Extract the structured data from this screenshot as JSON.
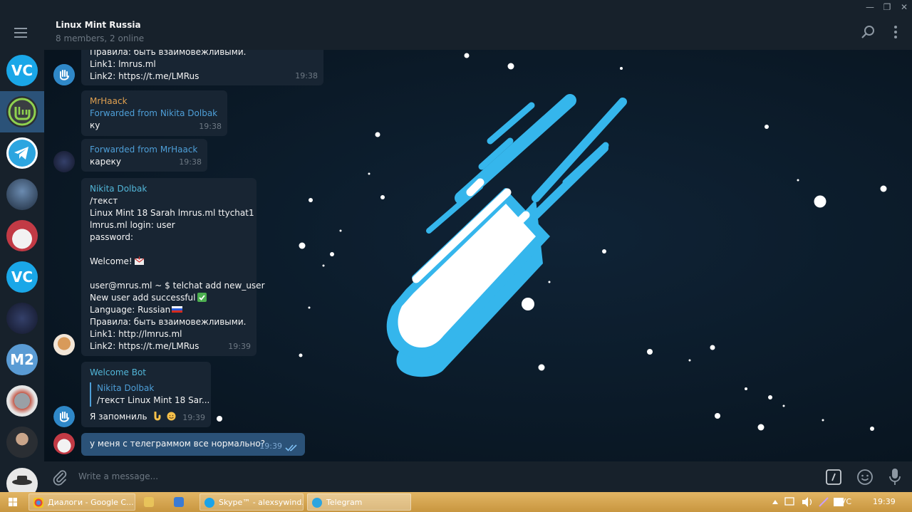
{
  "window": {
    "minimize": "—",
    "restore": "❐",
    "close": "✕"
  },
  "header": {
    "title": "Linux Mint Russia",
    "subtitle": "8 members, 2 online"
  },
  "sidebar": {
    "items": [
      {
        "initials": "VC",
        "color": "#1aa7e8"
      },
      {
        "initials": "",
        "color": "#2b2f33"
      },
      {
        "initials": "",
        "color": "#2ca5e0"
      },
      {
        "initials": "",
        "color": "#1d2b3d"
      },
      {
        "initials": "",
        "color": "#c23a45"
      },
      {
        "initials": "VC",
        "color": "#1aa7e8"
      },
      {
        "initials": "",
        "color": "#1a2038"
      },
      {
        "initials": "M2",
        "color": "#5a9bd4"
      },
      {
        "initials": "",
        "color": "#c45a4a"
      },
      {
        "initials": "",
        "color": "#3a3f44"
      },
      {
        "initials": "",
        "color": "#e8e8e8"
      }
    ]
  },
  "messages": {
    "m1": {
      "lines": [
        "Правила: быть взаимовежливыми.",
        "Link1: lmrus.ml",
        "Link2: https://t.me/LMRus"
      ],
      "time": "19:38"
    },
    "m2": {
      "sender": "MrHaack",
      "forwarded": "Forwarded from Nikita Dolbak",
      "text": "ку",
      "time": "19:38"
    },
    "m3": {
      "forwarded": "Forwarded from MrHaack",
      "text": "кареку",
      "time": "19:38"
    },
    "m4": {
      "sender": "Nikita Dolbak",
      "lines": [
        "/текст",
        "Linux Mint 18 Sarah lmrus.ml ttychat1",
        "lmrus.ml login: user",
        "password:",
        "",
        "Welcome!",
        "",
        "user@mrus.ml ~ $ telchat add new_user",
        "New user add successful",
        "Language: Russian",
        "Правила: быть взаимовежливыми.",
        "Link1: http://lmrus.ml",
        "Link2: https://t.me/LMRus"
      ],
      "time": "19:39"
    },
    "m5": {
      "sender": "Welcome Bot",
      "reply_author": "Nikita Dolbak",
      "reply_text": "/текст Linux Mint 18 Sar...",
      "text": "Я запомниль",
      "time": "19:39"
    },
    "m6": {
      "text": "у меня с телеграммом все нормально?",
      "time": "19:39"
    }
  },
  "composer": {
    "placeholder": "Write a message..."
  },
  "taskbar": {
    "tasks": [
      {
        "label": "Диалоги - Google C...",
        "icon_color": "#e04a3a"
      },
      {
        "label": "",
        "icon_color": "#e8c35a"
      },
      {
        "label": "",
        "icon_color": "#3a7bd5"
      },
      {
        "label": "Skype™ - alexsywind...",
        "icon_color": "#1aa3e8"
      },
      {
        "label": "Telegram",
        "icon_color": "#2ca5e0"
      }
    ],
    "lang": "РУС",
    "clock": "19:39"
  }
}
